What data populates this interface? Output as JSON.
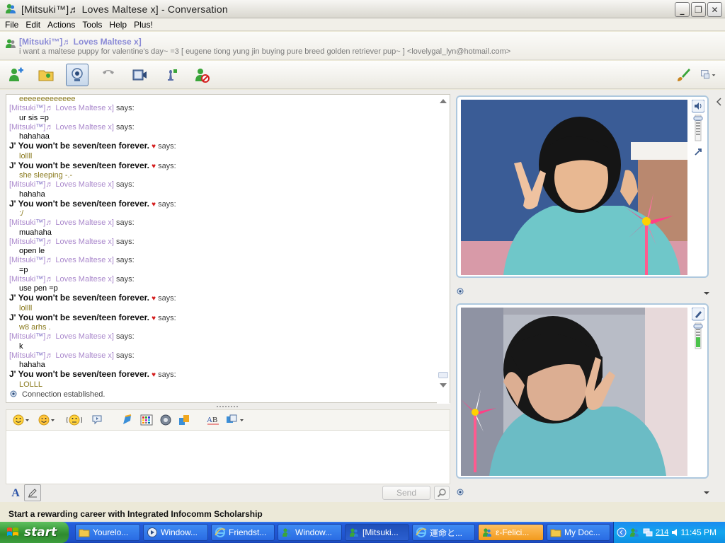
{
  "window": {
    "title": "[Mitsuki™]♬ Loves Maltese  x]  - Conversation"
  },
  "menu": [
    "File",
    "Edit",
    "Actions",
    "Tools",
    "Help",
    "Plus!"
  ],
  "contact": {
    "name": "[Mitsuki™]♬ Loves Maltese  x]",
    "personal_message": "i want a maltese puppy for valentine's day~ =3  [ eugene tiong yung jin buying pure breed golden retriever pup~ ] <lovelygal_lyn@hotmail.com>"
  },
  "toolbar": {
    "icons": [
      "invite-contact-icon",
      "send-files-icon",
      "webcam-icon",
      "call-icon",
      "video-icon",
      "games-icon",
      "block-icon",
      "paint-brush-icon",
      "display-menu-icon"
    ]
  },
  "conversation": {
    "top_partial": "eeeeeeeeeeeee",
    "says": "says:",
    "messages": [
      {
        "from": "m",
        "text": "ur sis =p"
      },
      {
        "from": "m",
        "text": "hahahaa"
      },
      {
        "from": "j",
        "text": "lollll"
      },
      {
        "from": "j",
        "text": "she sleeping -.-"
      },
      {
        "from": "m",
        "text": "hahaha"
      },
      {
        "from": "j",
        "text": ":/"
      },
      {
        "from": "m",
        "text": "muahaha"
      },
      {
        "from": "m",
        "text": "open le"
      },
      {
        "from": "m",
        "text": "=p"
      },
      {
        "from": "m",
        "text": "use pen =p"
      },
      {
        "from": "j",
        "text": "lollll"
      },
      {
        "from": "j",
        "text": "w8 arhs ."
      },
      {
        "from": "m",
        "text": "k"
      },
      {
        "from": "m",
        "text": "hahaha"
      },
      {
        "from": "j",
        "text": "LOLLL"
      }
    ],
    "name_m_main": "[Mitsuki",
    "name_m_tm": "™",
    "name_m_rest": "]♬ Loves Maltese  x]",
    "name_j": "J' You won't be seven/teen forever.",
    "status": "Connection established."
  },
  "format_toolbar": {
    "icons": [
      "emoticon-icon",
      "wink-icon",
      "nudge-icon",
      "voice-clip-icon",
      "ink-icon",
      "background-icon",
      "sound-icon",
      "share-icon",
      "font-check-icon",
      "more-icon"
    ]
  },
  "input": {
    "font_label": "A",
    "send_label": "Send"
  },
  "ad": {
    "text": "Start a rewarding career with Integrated Infocomm Scholarship"
  },
  "taskbar": {
    "start_label": "start",
    "tasks": [
      {
        "label": "Yourelo...",
        "icon": "folder-icon"
      },
      {
        "label": "Window...",
        "icon": "media-player-icon"
      },
      {
        "label": "Friendst...",
        "icon": "ie-icon"
      },
      {
        "label": "Window...",
        "icon": "messenger-icon"
      },
      {
        "label": "[Mitsuki...",
        "icon": "messenger-icon"
      },
      {
        "label": "運命と...",
        "icon": "ie-icon"
      },
      {
        "label": "ε-Felici...",
        "icon": "messenger-icon"
      },
      {
        "label": "My Doc...",
        "icon": "folder-icon"
      }
    ],
    "tray_count": "214",
    "clock": "11:45 PM"
  },
  "colors": {
    "title_text": "#222222",
    "contact_name": "#8a8ad6",
    "mitsuki_name": "#aa88cc",
    "j_text": "#8a7a1e",
    "taskbar_blue": "#245edb",
    "start_green": "#3c9c3c",
    "heart_red": "#d41c1c"
  }
}
